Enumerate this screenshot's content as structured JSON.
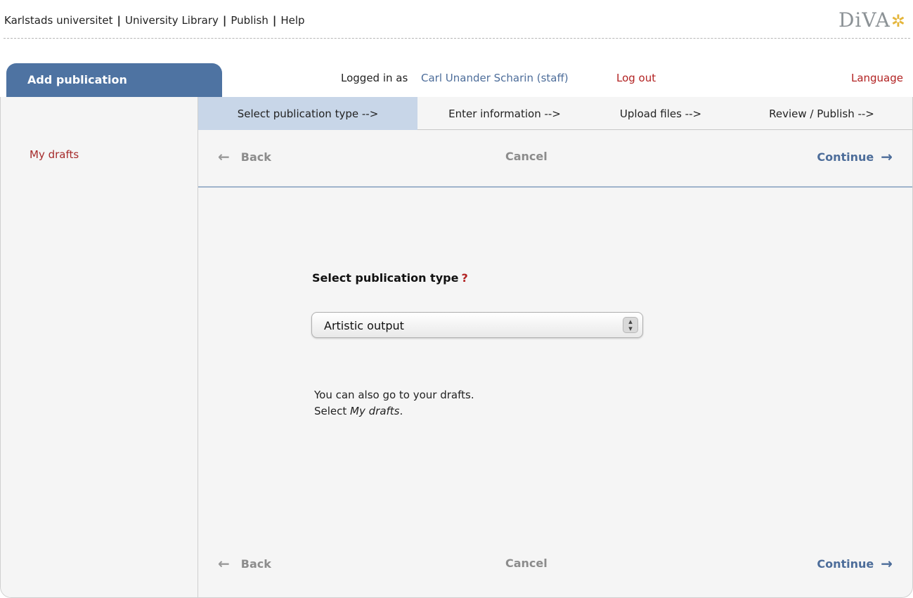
{
  "topnav": {
    "items": [
      "Karlstads universitet",
      "University Library",
      "Publish",
      "Help"
    ],
    "separator": "|"
  },
  "logo": {
    "text": "DiVA",
    "star": "✲"
  },
  "header": {
    "active_tab": "Add publication",
    "logged_in_label": "Logged in as",
    "user": "Carl Unander Scharin (staff)",
    "logout": "Log out",
    "language": "Language"
  },
  "sidebar": {
    "my_drafts": "My drafts"
  },
  "steps": [
    "Select publication type -->",
    "Enter information -->",
    "Upload files -->",
    "Review / Publish -->"
  ],
  "nav": {
    "back": "Back",
    "cancel": "Cancel",
    "continue": "Continue",
    "back_icon": "arrow-left-icon",
    "continue_icon": "arrow-right-icon"
  },
  "main": {
    "select_label": "Select publication type",
    "help_mark": "?",
    "selected_type": "Artistic output",
    "info_line1": "You can also go to your drafts.",
    "info_line2_prefix": "Select ",
    "info_line2_em": "My drafts",
    "info_line2_suffix": "."
  },
  "colors": {
    "tab_bg": "#4e73a2",
    "active_step_bg": "#c8d6e8",
    "link_blue": "#4d6d9a",
    "link_red": "#b22222"
  }
}
